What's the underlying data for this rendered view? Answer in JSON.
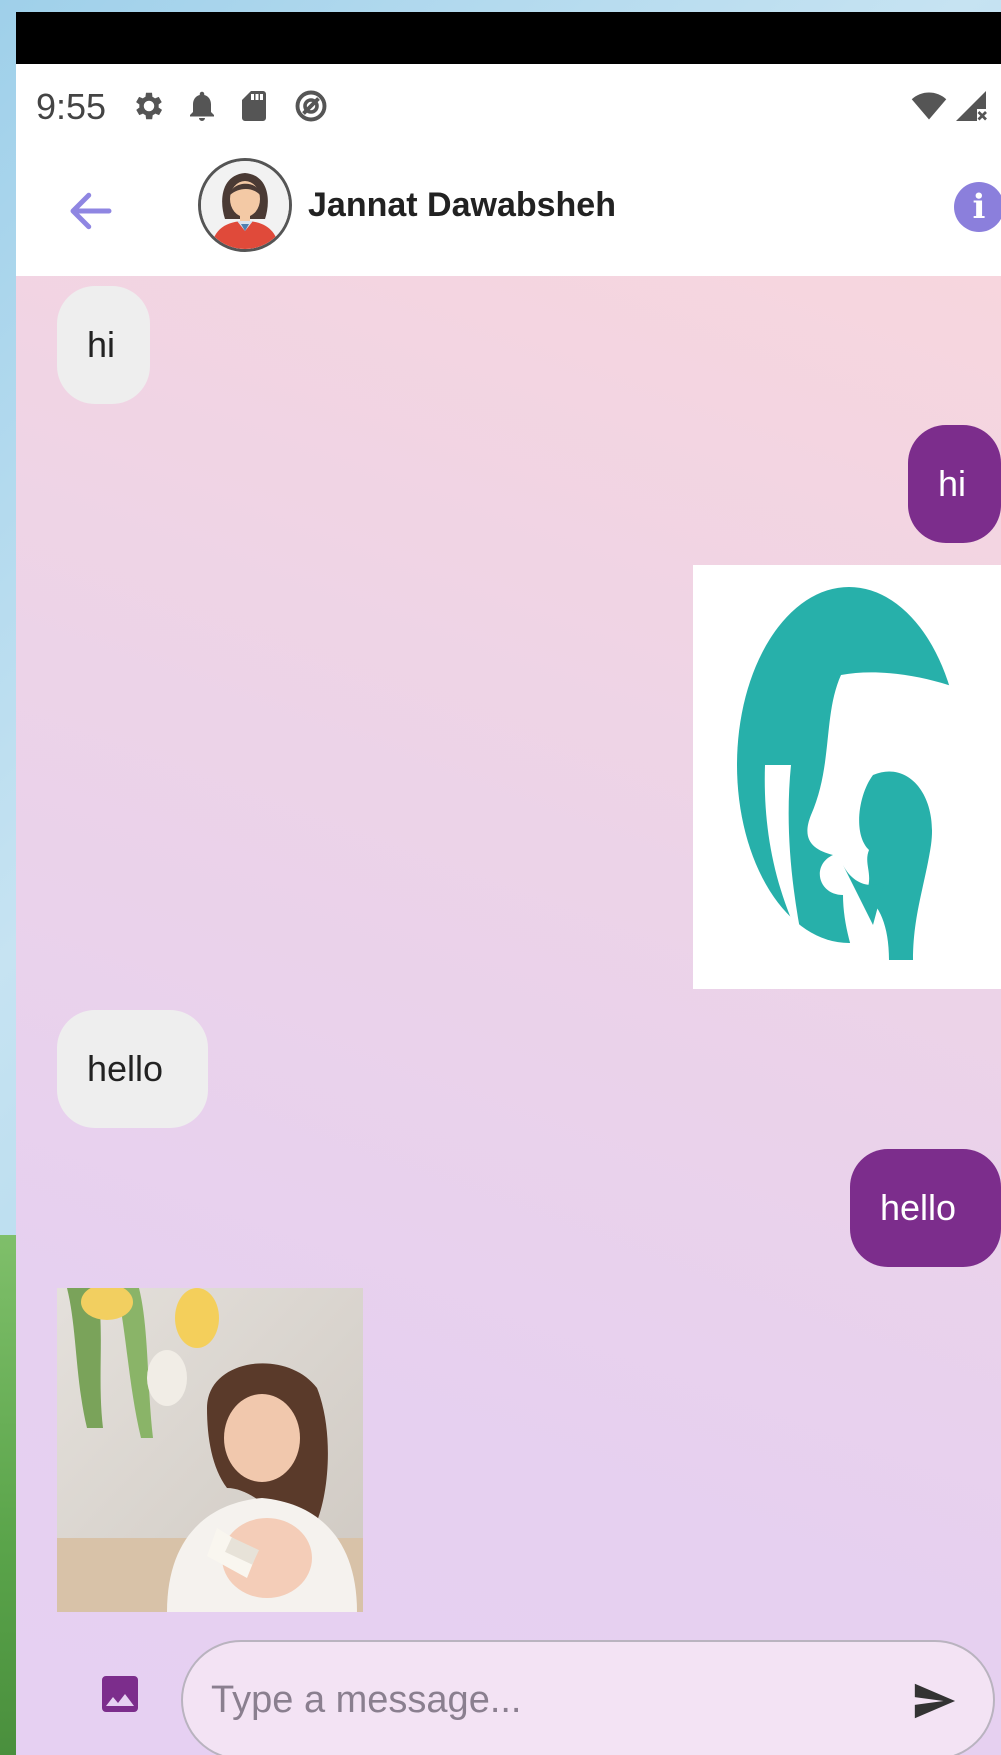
{
  "status_bar": {
    "time": "9:55",
    "icons": [
      "gear-icon",
      "bell-icon",
      "sd-card-icon",
      "sync-icon",
      "wifi-icon",
      "signal-icon"
    ]
  },
  "header": {
    "contact_name": "Jannat Dawabsheh",
    "back_icon": "arrow-left-icon",
    "info_label": "i"
  },
  "messages": [
    {
      "direction": "incoming",
      "type": "text",
      "text": "hi"
    },
    {
      "direction": "outgoing",
      "type": "text",
      "text": "hi"
    },
    {
      "direction": "outgoing",
      "type": "image",
      "image": "mother-child-silhouette-logo"
    },
    {
      "direction": "incoming",
      "type": "text",
      "text": "hello"
    },
    {
      "direction": "outgoing",
      "type": "text",
      "text": "hello"
    },
    {
      "direction": "incoming",
      "type": "image",
      "image": "mother-feeding-baby-photo"
    }
  ],
  "composer": {
    "placeholder": "Type a message...",
    "value": ""
  },
  "colors": {
    "outgoing_bubble": "#7c2d8c",
    "incoming_bubble": "#eeeeee",
    "accent": "#8b7fdc",
    "image_button": "#7c2d8c",
    "logo_teal": "#27b0aa"
  }
}
